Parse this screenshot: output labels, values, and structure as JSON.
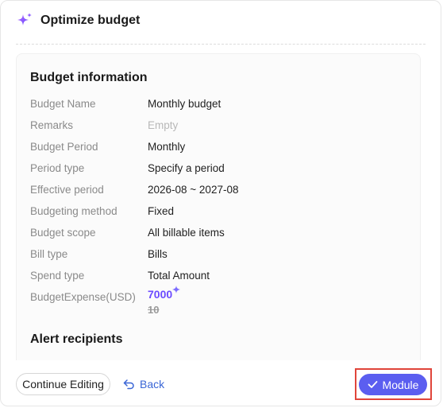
{
  "header": {
    "title": "Optimize budget",
    "icon": "sparkle-icon"
  },
  "budget_info": {
    "section_title": "Budget information",
    "rows": [
      {
        "label": "Budget Name",
        "value": "Monthly budget"
      },
      {
        "label": "Remarks",
        "value": "Empty"
      },
      {
        "label": "Budget Period",
        "value": "Monthly"
      },
      {
        "label": "Period type",
        "value": "Specify a period"
      },
      {
        "label": "Effective period",
        "value": "2026-08 ~ 2027-08"
      },
      {
        "label": "Budgeting method",
        "value": "Fixed"
      },
      {
        "label": "Budget scope",
        "value": "All billable items"
      },
      {
        "label": "Bill type",
        "value": "Bills"
      },
      {
        "label": "Spend type",
        "value": "Total Amount"
      }
    ],
    "expense": {
      "label": "BudgetExpense(USD)",
      "new_value": "7000",
      "old_value": "10"
    }
  },
  "alert": {
    "section_title": "Alert recipients"
  },
  "footer": {
    "continue_label": "Continue Editing",
    "back_label": "Back",
    "module_label": "Module"
  },
  "colors": {
    "accent": "#5b5ef0",
    "sparkle": "#7b5cf5",
    "highlight": "#e0453a"
  }
}
